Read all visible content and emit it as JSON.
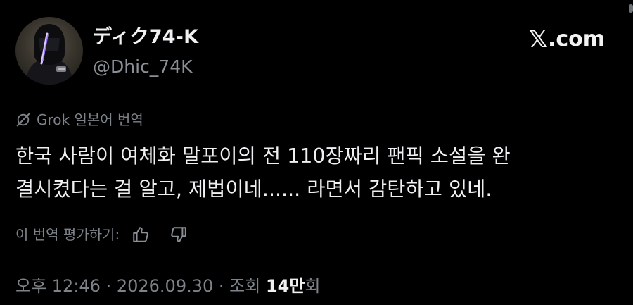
{
  "author": {
    "display_name": "ディク74-K",
    "handle": "@Dhic_74K"
  },
  "brand": {
    "logo_glyph": "𝕏",
    "text": ".com"
  },
  "translation": {
    "icon": "grok-icon",
    "label": "Grok 일본어 번역"
  },
  "tweet": {
    "lines": [
      "한국 사람이 여체화 말포이의 전 110장짜리 팬픽 소설을 완",
      "결시켰다는 걸 알고, 제법이네...... 라면서 감탄하고 있네."
    ]
  },
  "rating": {
    "label": "이 번역 평가하기:",
    "like_icon": "thumbs-up-icon",
    "dislike_icon": "thumbs-down-icon"
  },
  "meta": {
    "time": "오후 12:46",
    "separator": " · ",
    "date": "2026.09.30",
    "views_label": "조회",
    "views_count": "14만",
    "views_suffix": "회"
  },
  "colors": {
    "background": "#000000",
    "primary_text": "#e7e9ea",
    "secondary_text": "#7e8389"
  }
}
